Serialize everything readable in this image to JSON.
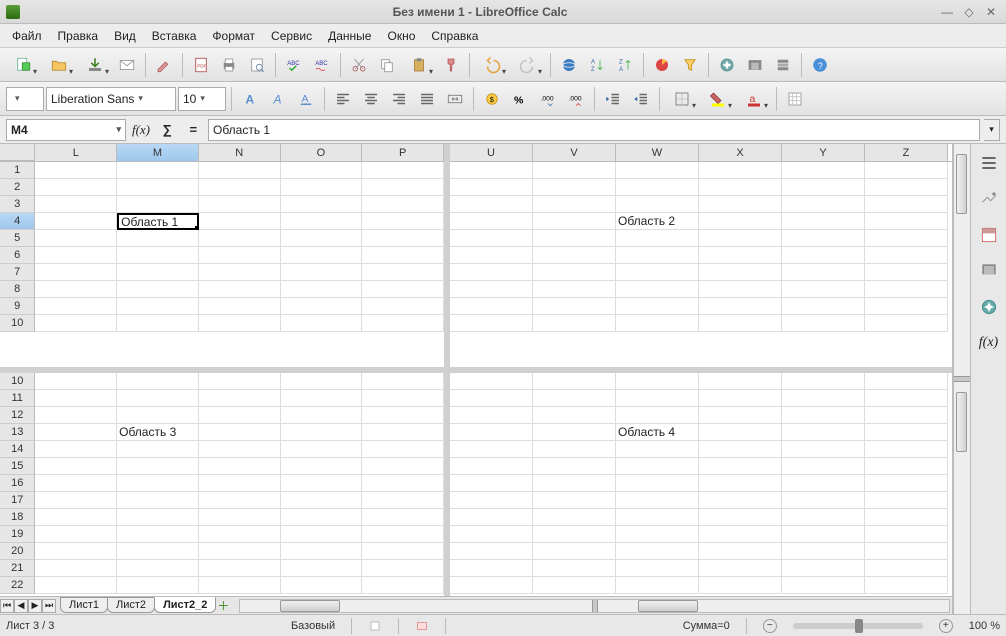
{
  "window": {
    "title": "Без имени 1 - LibreOffice Calc"
  },
  "menu": [
    "Файл",
    "Правка",
    "Вид",
    "Вставка",
    "Формат",
    "Сервис",
    "Данные",
    "Окно",
    "Справка"
  ],
  "format": {
    "font": "Liberation Sans",
    "size": "10"
  },
  "namebox": "M4",
  "formula": "Область 1",
  "panes": {
    "topLeft": {
      "cols": [
        "L",
        "M",
        "N",
        "O",
        "P"
      ],
      "rows": [
        1,
        2,
        3,
        4,
        5,
        6,
        7,
        8,
        9,
        10
      ],
      "cells": {
        "M4": "Область 1"
      },
      "activeCol": "M",
      "activeRow": 4
    },
    "topRight": {
      "cols": [
        "U",
        "V",
        "W",
        "X",
        "Y",
        "Z"
      ],
      "rows": [
        1,
        2,
        3,
        4,
        5,
        6,
        7,
        8,
        9,
        10
      ],
      "cells": {
        "W4": "Область 2"
      }
    },
    "botLeft": {
      "cols": [
        "L",
        "M",
        "N",
        "O",
        "P"
      ],
      "rows": [
        10,
        11,
        12,
        13,
        14,
        15,
        16,
        17,
        18,
        19,
        20,
        21,
        22
      ],
      "cells": {
        "M13": "Область 3"
      }
    },
    "botRight": {
      "cols": [
        "U",
        "V",
        "W",
        "X",
        "Y",
        "Z"
      ],
      "rows": [
        10,
        11,
        12,
        13,
        14,
        15,
        16,
        17,
        18,
        19,
        20,
        21,
        22
      ],
      "cells": {
        "W13": "Область 4"
      }
    }
  },
  "tabs": {
    "list": [
      "Лист1",
      "Лист2",
      "Лист2_2"
    ],
    "active": 2
  },
  "status": {
    "sheet": "Лист 3 / 3",
    "style": "Базовый",
    "sum": "Сумма=0",
    "zoom": "100 %"
  }
}
